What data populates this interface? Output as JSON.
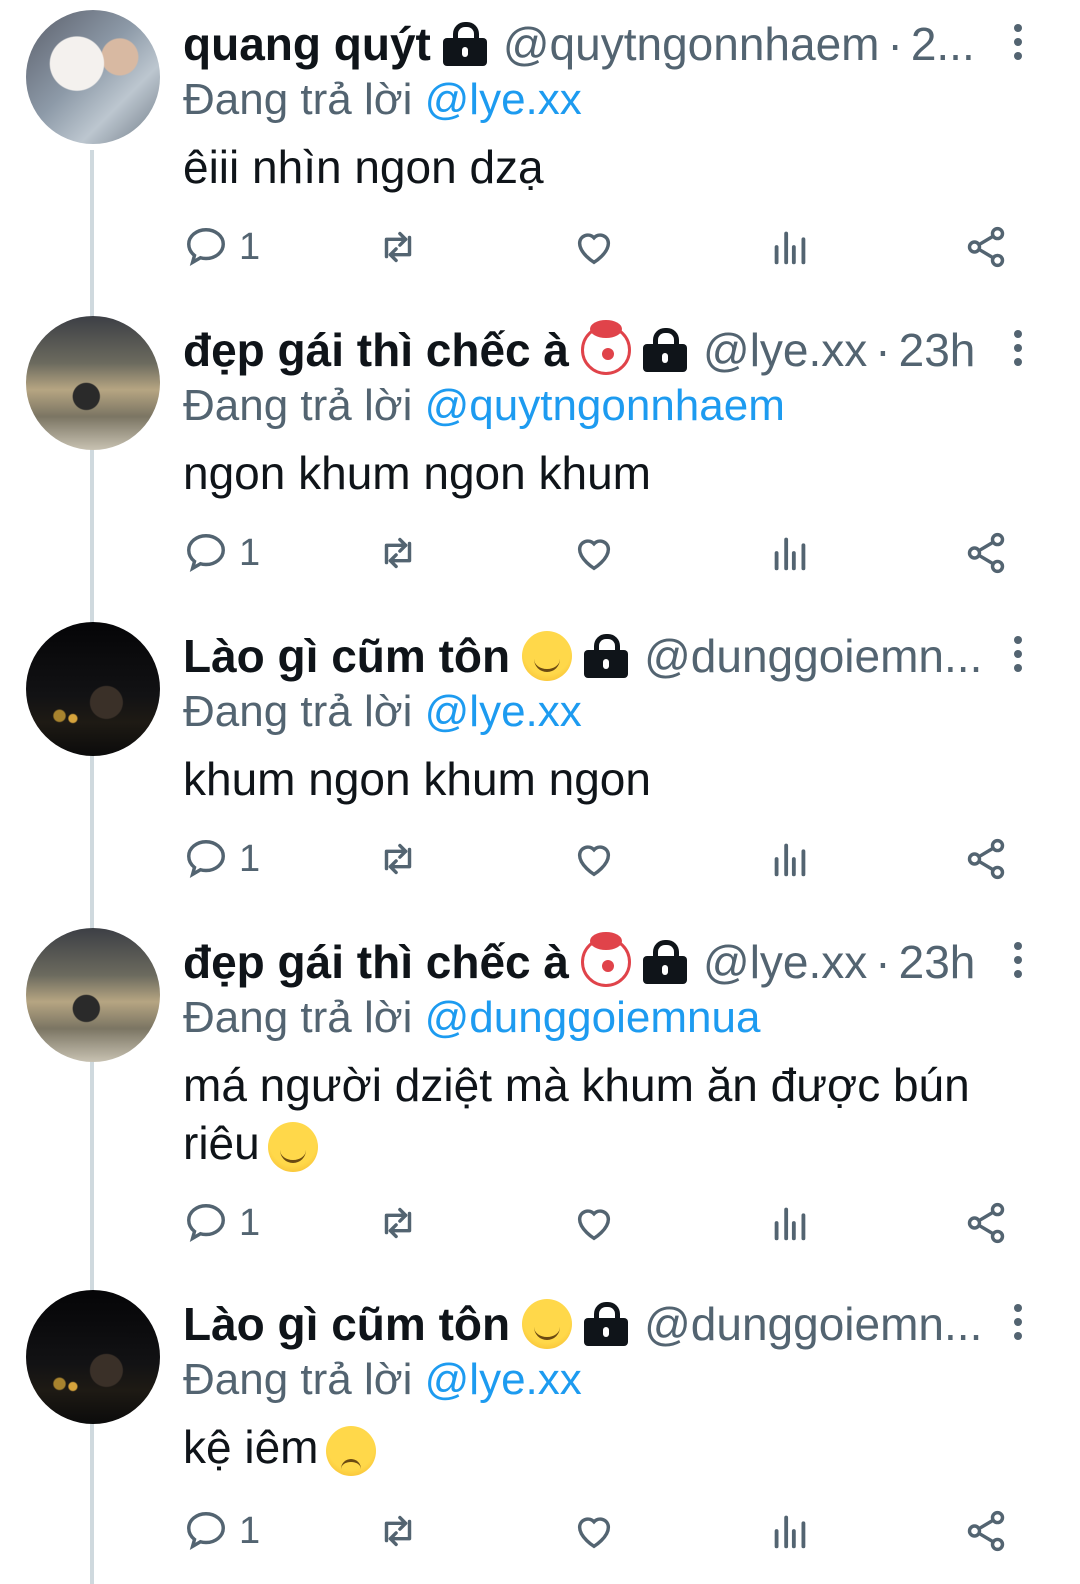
{
  "reply_prefix": "Đang trả lời",
  "tweets": [
    {
      "name": "quang quýt",
      "name_emoji": "",
      "locked": true,
      "handle": "@quytngonnhaem",
      "time": "2...",
      "reply_to": "@lye.xx",
      "text": "êiii nhìn ngon dzạ",
      "text_emoji": "",
      "reply_count": "1",
      "avatar": "dog-photo"
    },
    {
      "name": "đẹp gái thì chếc à",
      "name_emoji": "clown-face",
      "locked": true,
      "handle": "@lye.xx",
      "time": "23h",
      "reply_to": "@quytngonnhaem",
      "text": "ngon khum ngon khum",
      "text_emoji": "",
      "reply_count": "1",
      "avatar": "pool-photo"
    },
    {
      "name": "Lào gì cũm tôn",
      "name_emoji": "smiling-face",
      "locked": true,
      "handle": "@dunggoiemn...",
      "time": "",
      "reply_to": "@lye.xx",
      "text": "khum ngon khum ngon",
      "text_emoji": "",
      "reply_count": "1",
      "avatar": "night-photo"
    },
    {
      "name": "đẹp gái thì chếc à",
      "name_emoji": "clown-face",
      "locked": true,
      "handle": "@lye.xx",
      "time": "23h",
      "reply_to": "@dunggoiemnua",
      "text_line1": "má người dziệt mà khum ăn được bún",
      "text_line2": "riêu",
      "text_emoji": "smirking-face",
      "reply_count": "1",
      "avatar": "pool-photo"
    },
    {
      "name": "Lào gì cũm tôn",
      "name_emoji": "smiling-face",
      "locked": true,
      "handle": "@dunggoiemn...",
      "time": "",
      "reply_to": "@lye.xx",
      "text": "kệ iêm",
      "text_emoji": "pensive-face",
      "reply_count": "1",
      "avatar": "night-photo"
    }
  ],
  "icons": {
    "reply": "speech-bubble-icon",
    "retweet": "retweet-icon",
    "like": "heart-icon",
    "views": "bar-chart-icon",
    "share": "share-icon",
    "more": "vertical-dots-icon",
    "lock": "lock-icon"
  },
  "colors": {
    "text": "#0f1419",
    "secondary": "#536471",
    "link": "#1d9bf0",
    "thread_line": "#cfd9de"
  }
}
